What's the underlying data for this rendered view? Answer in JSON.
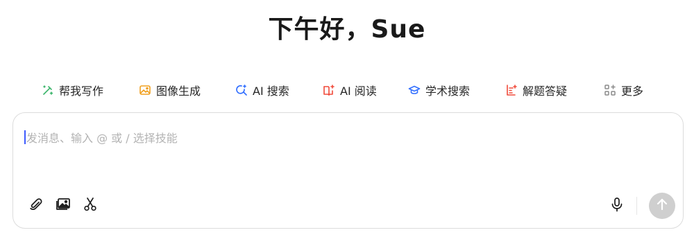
{
  "greeting": "下午好，Sue",
  "skills": [
    {
      "label": "帮我写作",
      "icon": "pen-sparkle-icon",
      "color": "#3bb56b"
    },
    {
      "label": "图像生成",
      "icon": "image-sparkle-icon",
      "color": "#f0a020"
    },
    {
      "label": "AI 搜索",
      "icon": "search-sparkle-icon",
      "color": "#3370ff"
    },
    {
      "label": "AI 阅读",
      "icon": "book-sparkle-icon",
      "color": "#f04a3a"
    },
    {
      "label": "学术搜索",
      "icon": "graduation-cap-icon",
      "color": "#3370ff"
    },
    {
      "label": "解题答疑",
      "icon": "problem-solving-icon",
      "color": "#f04a3a"
    },
    {
      "label": "更多",
      "icon": "grid-plus-icon",
      "color": "#8a8a8a"
    }
  ],
  "composer": {
    "placeholder": "发消息、输入 @ 或 / 选择技能",
    "tools": {
      "attach": "paperclip-icon",
      "image": "image-upload-icon",
      "screenshot": "scissors-icon",
      "voice": "microphone-icon",
      "send": "arrow-up-icon"
    },
    "send_color": "#cfcfcf"
  }
}
